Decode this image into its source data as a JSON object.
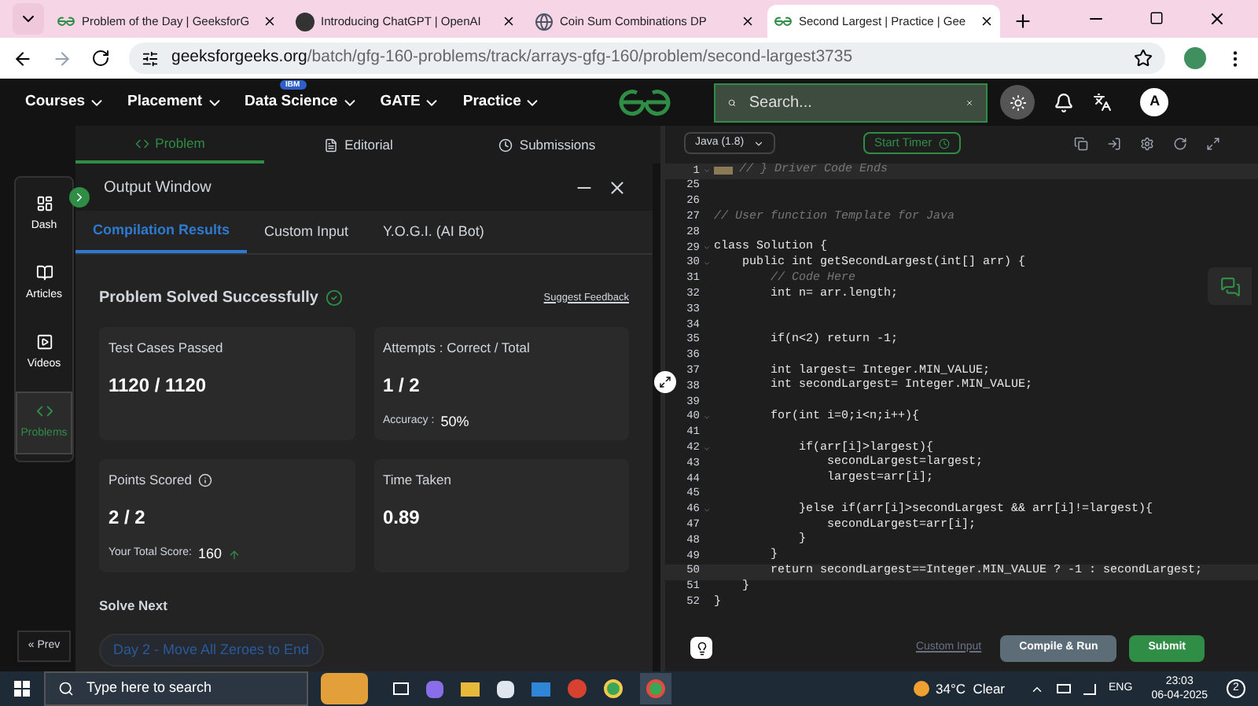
{
  "browser_tabs": [
    {
      "title": "Problem of the Day | GeeksforG",
      "kind": "gfg",
      "selected": false
    },
    {
      "title": "Introducing ChatGPT | OpenAI",
      "kind": "dark",
      "selected": false
    },
    {
      "title": "Coin Sum Combinations DP",
      "kind": "globe",
      "selected": false
    },
    {
      "title": "Second Largest | Practice | Gee",
      "kind": "gfg",
      "selected": true
    }
  ],
  "address": {
    "domain": "geeksforgeeks.org",
    "path": "/batch/gfg-160-problems/track/arrays-gfg-160/problem/second-largest3735"
  },
  "nav": {
    "items": [
      {
        "label": "Courses"
      },
      {
        "label": "Placement"
      },
      {
        "label": "Data Science",
        "badge": "IBM"
      },
      {
        "label": "GATE"
      },
      {
        "label": "Practice"
      }
    ],
    "search_placeholder": "Search...",
    "avatar": "A"
  },
  "problem_tabs": [
    {
      "label": "Problem",
      "selected": true
    },
    {
      "label": "Editorial",
      "selected": false
    },
    {
      "label": "Submissions",
      "selected": false
    }
  ],
  "sidebar": {
    "items": [
      {
        "label": "Dash",
        "selected": false
      },
      {
        "label": "Articles",
        "selected": false
      },
      {
        "label": "Videos",
        "selected": false
      },
      {
        "label": "Problems",
        "selected": true
      }
    ],
    "prev": "« Prev"
  },
  "output": {
    "title": "Output Window",
    "tabs": [
      {
        "label": "Compilation Results",
        "selected": true
      },
      {
        "label": "Custom Input",
        "selected": false
      },
      {
        "label": "Y.O.G.I. (AI Bot)",
        "selected": false
      }
    ],
    "status": "Problem Solved Successfully",
    "feedback": "Suggest Feedback",
    "cards": [
      {
        "label": "Test Cases Passed",
        "value": "1120 / 1120"
      },
      {
        "label": "Attempts : Correct / Total",
        "value": "1 / 2",
        "note_label": "Accuracy :",
        "note_value": "50%"
      },
      {
        "label": "Points Scored",
        "info": true,
        "value": "2 / 2",
        "note_label": "Your Total Score:",
        "note_value": "160",
        "trend_up": true
      },
      {
        "label": "Time Taken",
        "value": "0.89"
      }
    ],
    "solve_next": "Solve Next",
    "next_problem": "Day 2 - Move All Zeroes to End"
  },
  "editor": {
    "language": "Java (1.8)",
    "timer": "Start Timer",
    "lines": [
      {
        "number": "1",
        "text": "// } Driver Code Ends",
        "kind": "comment",
        "foldable": true,
        "highlighted": true
      },
      {
        "number": "25",
        "foldable": false,
        "highlighted": false
      },
      {
        "number": "26",
        "foldable": false,
        "highlighted": false
      },
      {
        "number": "27",
        "text": "// User function Template for Java",
        "kind": "comment",
        "foldable": false,
        "highlighted": false
      },
      {
        "number": "28",
        "foldable": false,
        "highlighted": false
      },
      {
        "number": "29",
        "text": "class Solution {",
        "kind": "code",
        "foldable": true,
        "highlighted": false
      },
      {
        "number": "30",
        "text": "    public int getSecondLargest(int[] arr) {",
        "kind": "code",
        "foldable": true,
        "highlighted": false
      },
      {
        "number": "31",
        "text": "        // Code Here",
        "kind": "comment",
        "foldable": false,
        "highlighted": false
      },
      {
        "number": "32",
        "text": "        int n= arr.length;",
        "kind": "code",
        "foldable": false,
        "highlighted": false
      },
      {
        "number": "33",
        "foldable": false,
        "highlighted": false
      },
      {
        "number": "34",
        "foldable": false,
        "highlighted": false
      },
      {
        "number": "35",
        "text": "        if(n<2) return -1;",
        "kind": "code",
        "foldable": false,
        "highlighted": false
      },
      {
        "number": "36",
        "foldable": false,
        "highlighted": false
      },
      {
        "number": "37",
        "text": "        int largest= Integer.MIN_VALUE;",
        "kind": "code",
        "foldable": false,
        "highlighted": false
      },
      {
        "number": "38",
        "text": "        int secondLargest= Integer.MIN_VALUE;",
        "kind": "code",
        "foldable": false,
        "highlighted": false
      },
      {
        "number": "39",
        "foldable": false,
        "highlighted": false
      },
      {
        "number": "40",
        "text": "        for(int i=0;i<n;i++){",
        "kind": "code",
        "foldable": true,
        "highlighted": false
      },
      {
        "number": "41",
        "foldable": false,
        "highlighted": false
      },
      {
        "number": "42",
        "text": "            if(arr[i]>largest){",
        "kind": "code",
        "foldable": true,
        "highlighted": false
      },
      {
        "number": "43",
        "text": "                secondLargest=largest;",
        "kind": "code",
        "foldable": false,
        "highlighted": false
      },
      {
        "number": "44",
        "text": "                largest=arr[i];",
        "kind": "code",
        "foldable": false,
        "highlighted": false
      },
      {
        "number": "45",
        "foldable": false,
        "highlighted": false
      },
      {
        "number": "46",
        "text": "            }else if(arr[i]>secondLargest && arr[i]!=largest){",
        "kind": "code",
        "foldable": true,
        "highlighted": false
      },
      {
        "number": "47",
        "text": "                secondLargest=arr[i];",
        "kind": "code",
        "foldable": false,
        "highlighted": false
      },
      {
        "number": "48",
        "text": "            }",
        "kind": "code",
        "foldable": false,
        "highlighted": false
      },
      {
        "number": "49",
        "text": "        }",
        "kind": "code",
        "foldable": false,
        "highlighted": false
      },
      {
        "number": "50",
        "text": "        return secondLargest==Integer.MIN_VALUE ? -1 : secondLargest;",
        "kind": "code",
        "foldable": false,
        "highlighted": true
      },
      {
        "number": "51",
        "text": "    }",
        "kind": "code",
        "foldable": false,
        "highlighted": false
      },
      {
        "number": "52",
        "text": "}",
        "kind": "code",
        "foldable": false,
        "highlighted": false
      }
    ],
    "custom_input": "Custom Input",
    "compile": "Compile & Run",
    "submit": "Submit"
  },
  "taskbar": {
    "search_placeholder": "Type here to search",
    "weather": "34°C  Clear",
    "language": "ENG",
    "time": "23:03",
    "date": "06-04-2025",
    "notifications": "2"
  }
}
